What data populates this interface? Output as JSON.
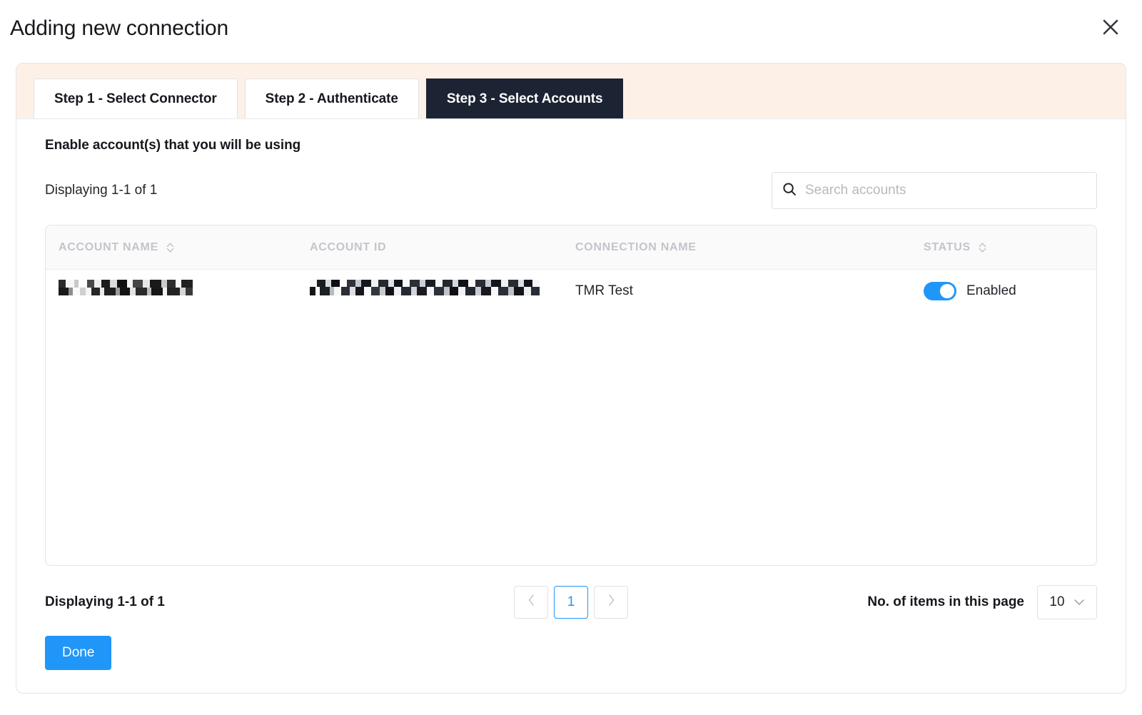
{
  "dialog": {
    "title": "Adding new connection",
    "close_icon": "close-icon"
  },
  "tabs": [
    {
      "label": "Step 1 - Select Connector",
      "active": false
    },
    {
      "label": "Step 2 - Authenticate",
      "active": false
    },
    {
      "label": "Step 3 - Select Accounts",
      "active": true
    }
  ],
  "content": {
    "section_title": "Enable account(s) that you will be using",
    "displaying_top": "Displaying 1-1 of 1"
  },
  "search": {
    "placeholder": "Search accounts",
    "value": "",
    "icon": "search-icon"
  },
  "table": {
    "columns": [
      {
        "label": "ACCOUNT NAME",
        "sortable": true
      },
      {
        "label": "ACCOUNT ID",
        "sortable": false
      },
      {
        "label": "CONNECTION NAME",
        "sortable": false
      },
      {
        "label": "STATUS",
        "sortable": true
      }
    ],
    "rows": [
      {
        "account_name": "",
        "account_name_redacted": true,
        "account_id": "",
        "account_id_redacted": true,
        "connection_name": "TMR Test",
        "status_label": "Enabled",
        "status_enabled": true
      }
    ]
  },
  "footer": {
    "displaying_bottom": "Displaying 1-1 of 1",
    "prev_label": "‹",
    "page_label": "1",
    "next_label": "›",
    "items_label": "No. of items in this page",
    "items_value": "10",
    "done_label": "Done"
  },
  "colors": {
    "accent": "#2196f9",
    "tab_active_bg": "#1c2433",
    "tab_strip_bg": "#fdf1e7",
    "header_text": "#c3c5cb"
  }
}
